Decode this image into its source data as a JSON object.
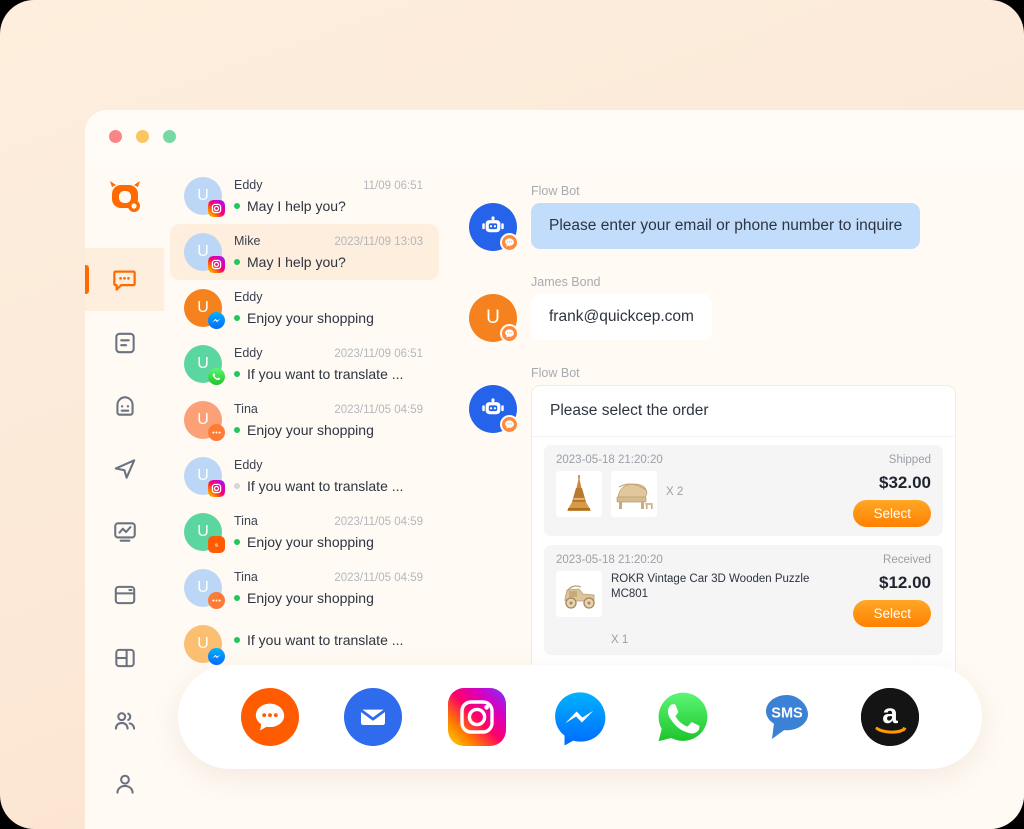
{
  "window": {
    "traffic_lights": [
      "close",
      "minimize",
      "maximize"
    ]
  },
  "sidebar": {
    "logo_name": "quickcep-logo",
    "items": [
      {
        "icon": "chat-bubble-icon",
        "name": "conversations",
        "active": true
      },
      {
        "icon": "document-icon",
        "name": "tickets",
        "active": false
      },
      {
        "icon": "robot-icon",
        "name": "chatbot",
        "active": false
      },
      {
        "icon": "send-icon",
        "name": "campaigns",
        "active": false
      },
      {
        "icon": "analytics-icon",
        "name": "analytics",
        "active": false
      },
      {
        "icon": "card-icon",
        "name": "orders",
        "active": false
      },
      {
        "icon": "layout-icon",
        "name": "workspace",
        "active": false
      },
      {
        "icon": "people-icon",
        "name": "team",
        "active": false
      },
      {
        "icon": "person-icon",
        "name": "profile",
        "active": false
      }
    ]
  },
  "chat_list": [
    {
      "name": "Eddy",
      "time": "11/09 06:51",
      "preview": "May I help you?",
      "avatar_color": "#bcd6f5",
      "initial": "U",
      "badge": "instagram",
      "unread": true,
      "selected": false
    },
    {
      "name": "Mike",
      "time": "2023/11/09 13:03",
      "preview": "May I help you?",
      "avatar_color": "#bcd6f5",
      "initial": "U",
      "badge": "instagram",
      "unread": true,
      "selected": true
    },
    {
      "name": "Eddy",
      "time": "",
      "preview": "Enjoy your shopping",
      "avatar_color": "#f5821f",
      "initial": "U",
      "badge": "messenger",
      "unread": true,
      "selected": false
    },
    {
      "name": "Eddy",
      "time": "2023/11/09 06:51",
      "preview": "If you want to translate ...",
      "avatar_color": "#5cd6a0",
      "initial": "U",
      "badge": "whatsapp",
      "unread": true,
      "selected": false
    },
    {
      "name": "Tina",
      "time": "2023/11/05 04:59",
      "preview": "Enjoy your shopping",
      "avatar_color": "#fba077",
      "initial": "U",
      "badge": "livechat",
      "unread": true,
      "selected": false
    },
    {
      "name": "Eddy",
      "time": "",
      "preview": "If you want to translate ...",
      "avatar_color": "#bcd6f5",
      "initial": "U",
      "badge": "instagram",
      "unread": false,
      "selected": false
    },
    {
      "name": "Tina",
      "time": "2023/11/05 04:59",
      "preview": "Enjoy your shopping",
      "avatar_color": "#5cd6a0",
      "initial": "U",
      "badge": "sms",
      "unread": true,
      "selected": false
    },
    {
      "name": "Tina",
      "time": "2023/11/05 04:59",
      "preview": "Enjoy your shopping",
      "avatar_color": "#bcd6f5",
      "initial": "U",
      "badge": "livechat",
      "unread": true,
      "selected": false
    },
    {
      "name": "",
      "time": "",
      "preview": "If you want to translate ...",
      "avatar_color": "#fbbf72",
      "initial": "U",
      "badge": "messenger",
      "unread": true,
      "selected": false
    }
  ],
  "conversation": [
    {
      "sender": "Flow Bot",
      "avatar": "bot",
      "bubble_style": "blue",
      "text": "Please enter your email or phone number to inquire"
    },
    {
      "sender": "James Bond",
      "avatar": "user",
      "bubble_style": "white",
      "text": "frank@quickcep.com"
    },
    {
      "sender": "Flow Bot",
      "avatar": "bot",
      "bubble_style": "card",
      "text": "Please select the order"
    }
  ],
  "order_card": {
    "title": "Please select the order",
    "orders": [
      {
        "date": "2023-05-18 21:20:20",
        "status": "Shipped",
        "product_title": "",
        "quantity": "X 2",
        "price": "$32.00",
        "select_label": "Select",
        "thumbs": [
          "eiffel-tower-puzzle",
          "wooden-piano-puzzle"
        ]
      },
      {
        "date": "2023-05-18 21:20:20",
        "status": "Received",
        "product_title": "ROKR Vintage Car 3D Wooden Puzzle MC801",
        "quantity": "X 1",
        "price": "$12.00",
        "select_label": "Select",
        "thumbs": [
          "vintage-car-puzzle"
        ]
      }
    ]
  },
  "channel_bar": {
    "channels": [
      {
        "name": "livechat",
        "label": "Live Chat"
      },
      {
        "name": "email",
        "label": "Email"
      },
      {
        "name": "instagram",
        "label": "Instagram"
      },
      {
        "name": "messenger",
        "label": "Messenger"
      },
      {
        "name": "whatsapp",
        "label": "WhatsApp"
      },
      {
        "name": "sms",
        "label": "SMS"
      },
      {
        "name": "amazon",
        "label": "Amazon"
      }
    ]
  },
  "colors": {
    "brand_orange": "#ff6a00",
    "accent_blue": "#2563eb",
    "bubble_blue": "#c2dcfb",
    "unread_green": "#22c55e",
    "background_peach": "#fcead9"
  }
}
